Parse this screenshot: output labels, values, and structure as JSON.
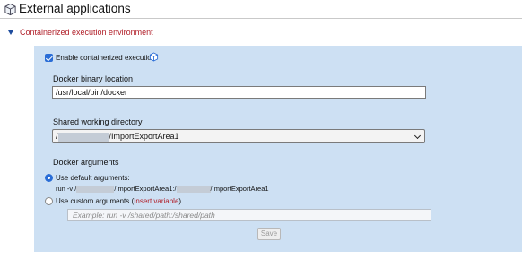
{
  "header": {
    "title": "External applications",
    "icon": "cube-icon"
  },
  "section": {
    "title": "Containerized execution environment",
    "expanded": true
  },
  "enable": {
    "label": "Enable containerized execution",
    "checked": true,
    "icon": "cube-icon"
  },
  "docker_binary": {
    "label": "Docker binary location",
    "value": "/usr/local/bin/docker"
  },
  "shared_dir": {
    "label": "Shared working directory",
    "value_prefix": "/",
    "value_suffix": "/ImportExportArea1"
  },
  "docker_args": {
    "label": "Docker arguments",
    "default_option": {
      "label": "Use default arguments:",
      "selected": true,
      "cmd_part1": "run -v /",
      "cmd_part2": "/ImportExportArea1:/",
      "cmd_part3": "/ImportExportArea1"
    },
    "custom_option": {
      "label": "Use custom arguments",
      "link_open": " (",
      "link_text": "Insert variable",
      "link_close": ")",
      "selected": false,
      "placeholder": "Example: run -v /shared/path:/shared/path"
    }
  },
  "save_label": "Save",
  "colors": {
    "panel": "#cde0f3",
    "section_title": "#b1202a",
    "accent": "#2a6dd6"
  }
}
